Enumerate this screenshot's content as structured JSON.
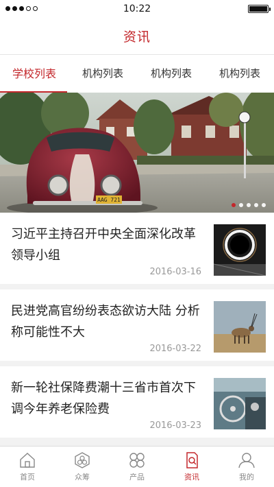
{
  "status_bar": {
    "carrier": "",
    "time": "10:22",
    "battery_level": 1.0
  },
  "nav": {
    "title": "资讯"
  },
  "tabs": [
    {
      "label": "学校列表",
      "active": true
    },
    {
      "label": "机构列表",
      "active": false
    },
    {
      "label": "机构列表",
      "active": false
    },
    {
      "label": "机构列表",
      "active": false
    }
  ],
  "banner": {
    "plate_text": "AAG 721",
    "page_count": 5,
    "current_page": 1
  },
  "news": [
    {
      "title": "习近平主持召开中央全面深化改革领导小组",
      "date": "2016-03-16",
      "thumb": "light-ring-photo"
    },
    {
      "title": "民进党高官纷纷表态欲访大陆 分析称可能性不大",
      "date": "2016-03-22",
      "thumb": "oryx-photo"
    },
    {
      "title": "新一轮社保降费潮十三省市首次下调今年养老保险费",
      "date": "2016-03-23",
      "thumb": "car-interior-photo"
    }
  ],
  "tab_bar": {
    "items": [
      {
        "label": "首页",
        "icon": "home-icon",
        "active": false
      },
      {
        "label": "众筹",
        "icon": "crowdfund-icon",
        "active": false
      },
      {
        "label": "产品",
        "icon": "product-icon",
        "active": false
      },
      {
        "label": "资讯",
        "icon": "news-icon",
        "active": true
      },
      {
        "label": "我的",
        "icon": "profile-icon",
        "active": false
      }
    ]
  },
  "colors": {
    "accent": "#c3272b",
    "muted": "#888888",
    "background": "#f2f2f2"
  }
}
